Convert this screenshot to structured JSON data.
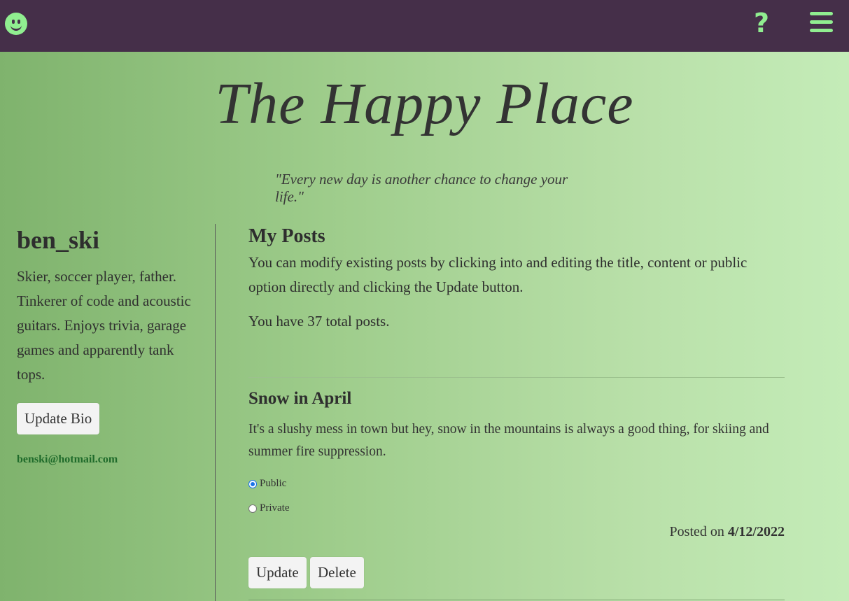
{
  "header": {
    "logo_icon": "smiley-face-icon",
    "help_label": "?",
    "menu_icon": "hamburger-menu-icon",
    "accent_color": "#90ee90",
    "bar_color": "#452f49"
  },
  "site": {
    "title": "The Happy Place",
    "quote": "\"Every new day is another chance to change your life.\""
  },
  "profile": {
    "username": "ben_ski",
    "bio": "Skier, soccer player, father. Tinkerer of code and acoustic guitars. Enjoys trivia, garage games and apparently tank tops.",
    "update_bio_label": "Update Bio",
    "email": "benski@hotmail.com"
  },
  "posts_section": {
    "heading": "My Posts",
    "intro": "You can modify existing posts by clicking into and editing the title, content or public option directly and clicking the Update button.",
    "count_text": "You have 37 total posts."
  },
  "posts": [
    {
      "title": "Snow in April",
      "content": "It's a slushy mess in town but hey, snow in the mountains is always a good thing, for skiing and summer fire suppression.",
      "visibility_options": [
        "Public",
        "Private"
      ],
      "selected_visibility": "Public",
      "posted_prefix": "Posted on",
      "posted_date": "4/12/2022",
      "update_label": "Update",
      "delete_label": "Delete"
    }
  ]
}
